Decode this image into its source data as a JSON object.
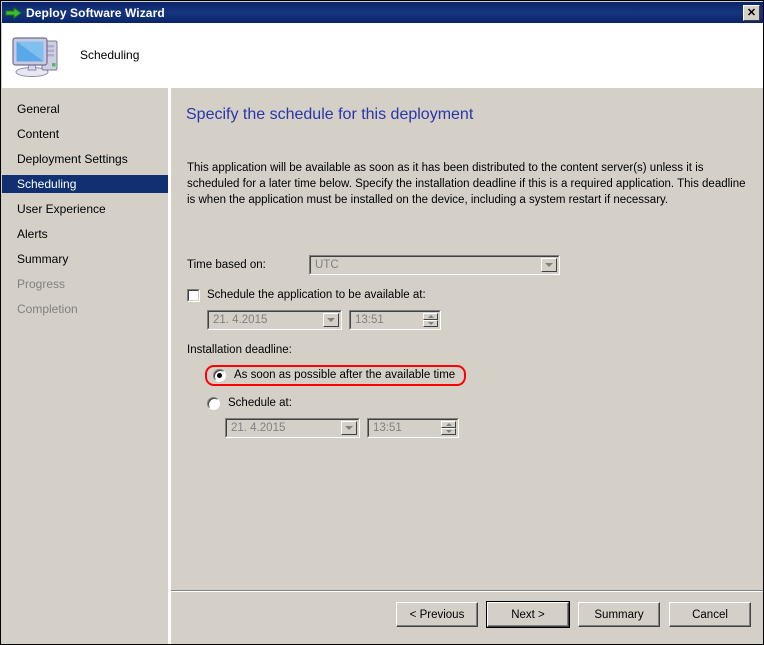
{
  "window": {
    "title": "Deploy Software Wizard",
    "title_icon": "green-arrow-icon",
    "close_label": "✕"
  },
  "header": {
    "icon": "computer-icon",
    "title": "Scheduling"
  },
  "sidebar": {
    "items": [
      {
        "label": "General",
        "state": "normal"
      },
      {
        "label": "Content",
        "state": "normal"
      },
      {
        "label": "Deployment Settings",
        "state": "normal"
      },
      {
        "label": "Scheduling",
        "state": "selected"
      },
      {
        "label": "User Experience",
        "state": "normal"
      },
      {
        "label": "Alerts",
        "state": "normal"
      },
      {
        "label": "Summary",
        "state": "normal"
      },
      {
        "label": "Progress",
        "state": "disabled"
      },
      {
        "label": "Completion",
        "state": "disabled"
      }
    ]
  },
  "content": {
    "heading": "Specify the schedule for this deployment",
    "intro": "This application will be available as soon as it has been distributed to the content server(s) unless it is scheduled for a later time below. Specify the installation deadline if this is a required application. This deadline is when the application must be installed on the device, including a system restart if necessary.",
    "time_based_on": {
      "label": "Time based on:",
      "value": "UTC",
      "enabled": false
    },
    "available_checkbox": {
      "label": "Schedule the application to be available at:",
      "checked": false
    },
    "available_datetime": {
      "date": "21. 4.2015",
      "time": "13:51",
      "enabled": false
    },
    "deadline_label": "Installation deadline:",
    "deadline_asap": {
      "label": "As soon as possible after the available time",
      "selected": true,
      "highlight_color": "#ff0000"
    },
    "deadline_schedule": {
      "label": "Schedule at:",
      "selected": false
    },
    "deadline_datetime": {
      "date": "21. 4.2015",
      "time": "13:51",
      "enabled": false
    }
  },
  "buttons": {
    "previous": "< Previous",
    "next": "Next >",
    "summary": "Summary",
    "cancel": "Cancel"
  },
  "colors": {
    "titlebar": "#0a246a",
    "face": "#d4d0c8",
    "heading": "#2a35a8",
    "selection": "#103071",
    "annotation": "#ff0000"
  }
}
